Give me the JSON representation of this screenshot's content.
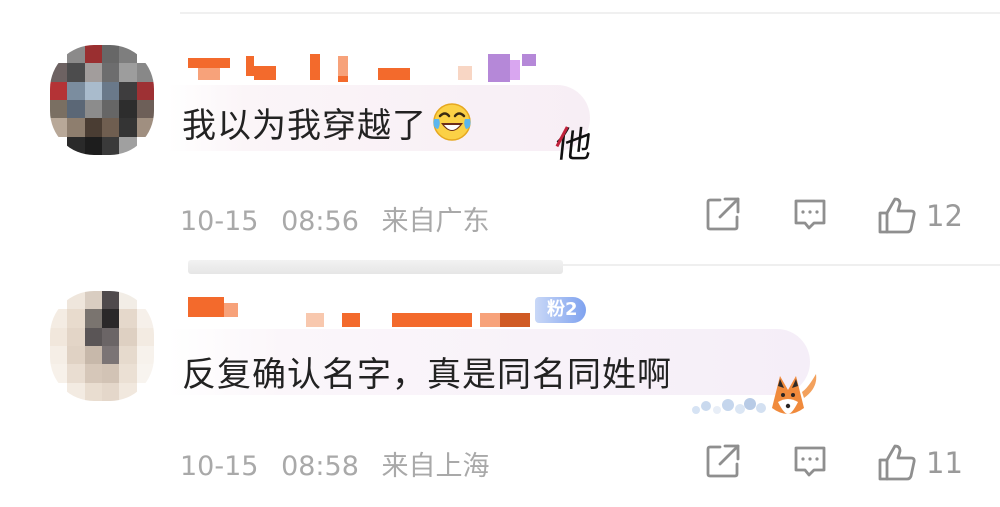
{
  "comments": [
    {
      "text": "我以为我穿越了",
      "emoji": "laughing-tears-emoji",
      "side_glyph": "他",
      "date": "10-15",
      "time": "08:56",
      "location": "来自广东",
      "likes": "12"
    },
    {
      "text": "反复确认名字，真是同名同姓啊",
      "fan_badge": "粉2",
      "decoration": "fox-sticker",
      "date": "10-15",
      "time": "08:58",
      "location": "来自上海",
      "likes": "11"
    }
  ],
  "icons": {
    "share": "share-icon",
    "reply": "comment-icon",
    "like": "thumbs-up-icon"
  },
  "colors": {
    "meta_text": "#a9a9a9",
    "icon": "#8f8f8f",
    "redacted_orange": "#f36a2c",
    "fan_badge": "#7fa2ef"
  }
}
